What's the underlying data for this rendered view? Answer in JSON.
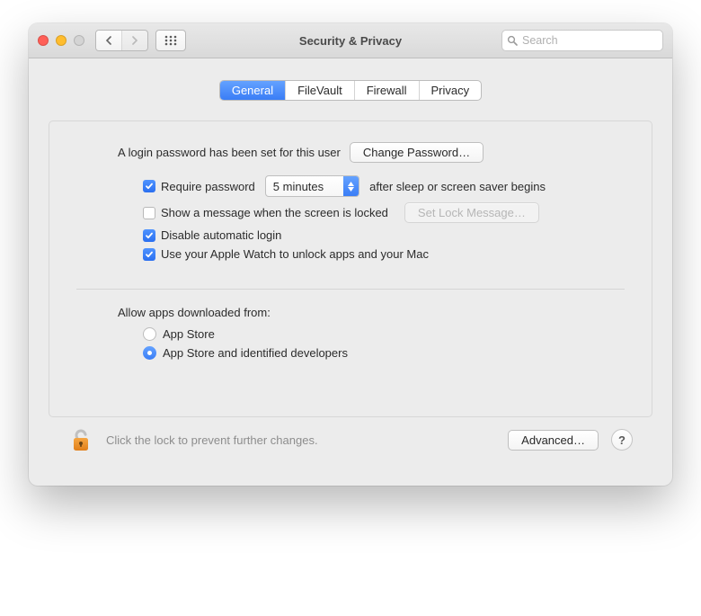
{
  "window": {
    "title": "Security & Privacy"
  },
  "search": {
    "placeholder": "Search"
  },
  "tabs": {
    "general": "General",
    "filevault": "FileVault",
    "firewall": "Firewall",
    "privacy": "Privacy"
  },
  "general": {
    "login_password_text": "A login password has been set for this user",
    "change_password_button": "Change Password…",
    "require_password_label": "Require password",
    "require_password_checked": true,
    "delay_select": "5 minutes",
    "after_sleep_text": "after sleep or screen saver begins",
    "show_message_label": "Show a message when the screen is locked",
    "show_message_checked": false,
    "set_lock_message_button": "Set Lock Message…",
    "disable_auto_login_label": "Disable automatic login",
    "disable_auto_login_checked": true,
    "apple_watch_label": "Use your Apple Watch to unlock apps and your Mac",
    "apple_watch_checked": true,
    "allow_apps_heading": "Allow apps downloaded from:",
    "radio_app_store": "App Store",
    "radio_identified": "App Store and identified developers",
    "radio_selected": "identified"
  },
  "footer": {
    "lock_text": "Click the lock to prevent further changes.",
    "advanced_button": "Advanced…"
  }
}
